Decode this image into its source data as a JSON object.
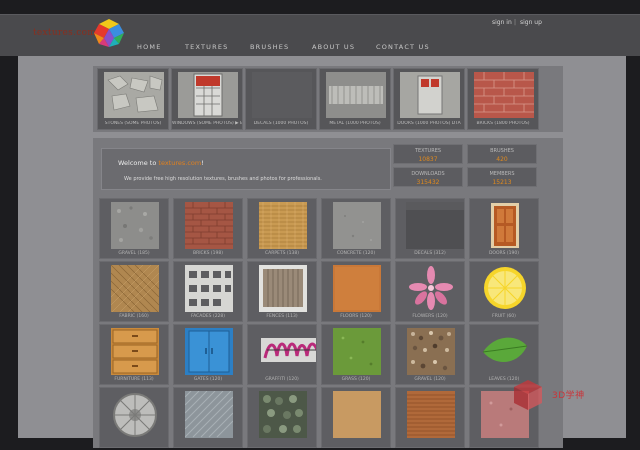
{
  "site": {
    "logo_text": "textures.com"
  },
  "auth": {
    "sign_in": "sign in",
    "separator": "|",
    "sign_up": "sign up"
  },
  "nav": [
    "HOME",
    "TEXTURES",
    "BRUSHES",
    "ABOUT US",
    "CONTACT US"
  ],
  "featured": [
    {
      "caption": "STONES (SOME PHOTOS)",
      "icon": "stone-wall-thumb"
    },
    {
      "caption": "WINDOWS (SOME PHOTOS) ▶ ENG",
      "icon": "window-thumb"
    },
    {
      "caption": "DECALS (1000 PHOTOS)",
      "icon": "blank-thumb"
    },
    {
      "caption": "METAL (1000 PHOTOS)",
      "icon": "metal-thumb"
    },
    {
      "caption": "DOORS (1000 PHOTOS) DTA",
      "icon": "door-window-thumb"
    },
    {
      "caption": "BRICKS (1800 PHOTOS)",
      "icon": "bricks-thumb"
    }
  ],
  "welcome": {
    "title_prefix": "Welcome to",
    "brand": "textures.com",
    "title_suffix": "!",
    "text": "We provide free high resolution textures, brushes and photos for professionals."
  },
  "stats": [
    {
      "label": "TEXTURES",
      "value": "10837"
    },
    {
      "label": "BRUSHES",
      "value": "420"
    },
    {
      "label": "DOWNLOADS",
      "value": "315432"
    },
    {
      "label": "MEMBERS",
      "value": "15213"
    }
  ],
  "grid": [
    {
      "caption": "GRAVEL (185)",
      "icon": "gravel-thumb"
    },
    {
      "caption": "BRICKS (198)",
      "icon": "brick-thumb"
    },
    {
      "caption": "CARPETS (138)",
      "icon": "carpet-thumb"
    },
    {
      "caption": "CONCRETE (120)",
      "icon": "concrete-thumb"
    },
    {
      "caption": "DECALS (312)",
      "icon": "decal-thumb"
    },
    {
      "caption": "DOORS (190)",
      "icon": "door-thumb"
    },
    {
      "caption": "FABRIC (160)",
      "icon": "fabric-thumb"
    },
    {
      "caption": "FACADES (228)",
      "icon": "facade-thumb"
    },
    {
      "caption": "FENCES (113)",
      "icon": "fence-thumb"
    },
    {
      "caption": "FLOORS (120)",
      "icon": "floor-thumb"
    },
    {
      "caption": "FLOWERS (120)",
      "icon": "flower-thumb"
    },
    {
      "caption": "FRUIT (60)",
      "icon": "lemon-thumb"
    },
    {
      "caption": "FURNITURE (113)",
      "icon": "drawer-thumb"
    },
    {
      "caption": "GATES (120)",
      "icon": "gate-thumb"
    },
    {
      "caption": "GRAFFITI (120)",
      "icon": "graffiti-thumb"
    },
    {
      "caption": "GRASS (120)",
      "icon": "grass-thumb"
    },
    {
      "caption": "GRAVEL (120)",
      "icon": "pebble-thumb"
    },
    {
      "caption": "LEAVES (120)",
      "icon": "leaf-thumb"
    },
    {
      "caption": "",
      "icon": "manhole-thumb"
    },
    {
      "caption": "",
      "icon": "metal-plate-thumb"
    },
    {
      "caption": "",
      "icon": "cobble-thumb"
    },
    {
      "caption": "",
      "icon": "sand-thumb"
    },
    {
      "caption": "",
      "icon": "wood-plank-thumb"
    },
    {
      "caption": "",
      "icon": "pink-stone-thumb"
    }
  ],
  "watermark": {
    "text": "3D学神"
  }
}
